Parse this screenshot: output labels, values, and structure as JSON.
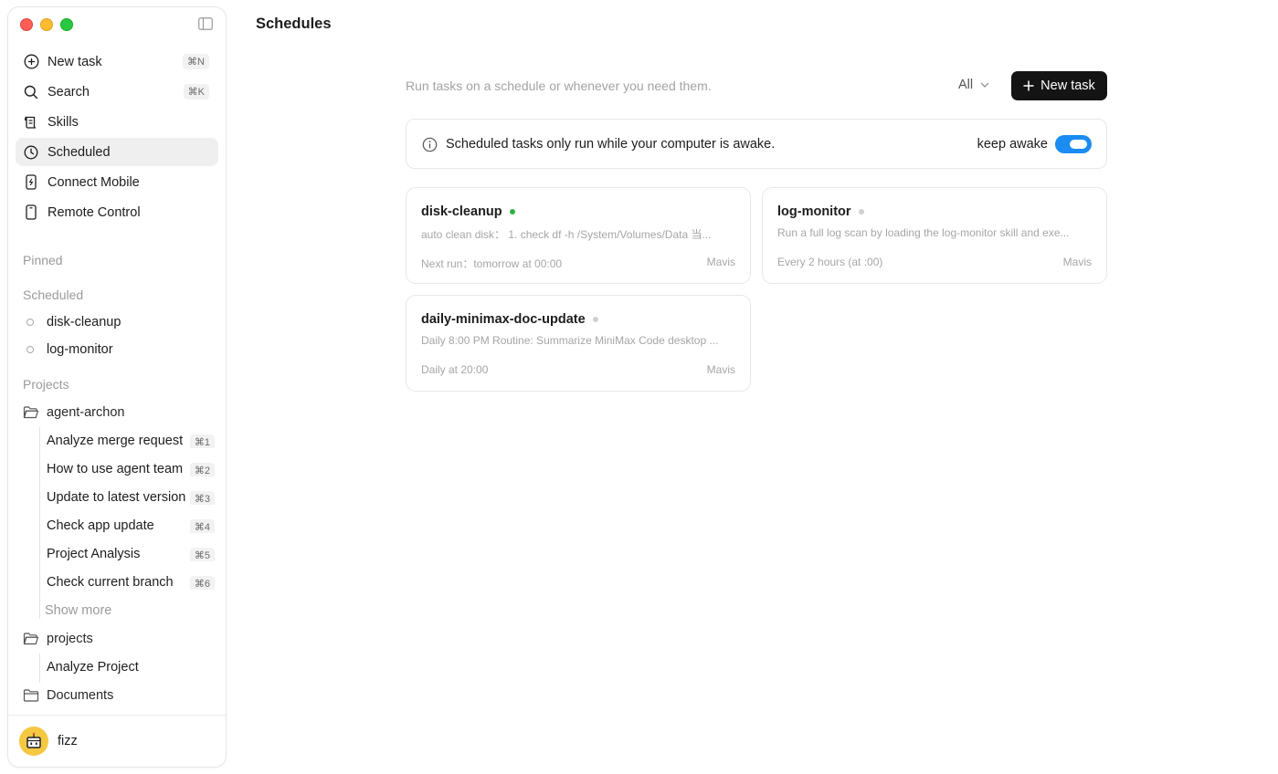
{
  "app": {
    "page_title": "Schedules"
  },
  "sidebar": {
    "nav": [
      {
        "label": "New task",
        "shortcut": "⌘N",
        "icon": "plus-circle-icon"
      },
      {
        "label": "Search",
        "shortcut": "⌘K",
        "icon": "search-icon"
      },
      {
        "label": "Skills",
        "shortcut": "",
        "icon": "scroll-icon"
      },
      {
        "label": "Scheduled",
        "shortcut": "",
        "icon": "clock-icon",
        "active": true
      },
      {
        "label": "Connect Mobile",
        "shortcut": "",
        "icon": "phone-icon"
      },
      {
        "label": "Remote Control",
        "shortcut": "",
        "icon": "remote-icon"
      }
    ],
    "pinned_label": "Pinned",
    "scheduled_label": "Scheduled",
    "scheduled_items": [
      "disk-cleanup",
      "log-monitor"
    ],
    "projects_label": "Projects",
    "projects": [
      {
        "name": "agent-archon",
        "items": [
          {
            "label": "Analyze merge request",
            "shortcut": "⌘1"
          },
          {
            "label": "How to use agent team",
            "shortcut": "⌘2"
          },
          {
            "label": "Update to latest version",
            "shortcut": "⌘3"
          },
          {
            "label": "Check app update",
            "shortcut": "⌘4"
          },
          {
            "label": "Project Analysis",
            "shortcut": "⌘5"
          },
          {
            "label": "Check current branch",
            "shortcut": "⌘6"
          }
        ],
        "show_more": "Show more"
      },
      {
        "name": "projects",
        "items": [
          {
            "label": "Analyze Project"
          }
        ]
      },
      {
        "name": "Documents",
        "items": []
      }
    ],
    "user": {
      "name": "fizz"
    }
  },
  "main": {
    "subtitle": "Run tasks on a schedule or whenever you need them.",
    "filter": "All",
    "new_task_label": "New task",
    "notice": {
      "message": "Scheduled tasks only run while your computer is awake.",
      "toggle_label": "keep awake",
      "toggle_on": true
    },
    "cards": [
      {
        "name": "disk-cleanup",
        "status_color": "#2fb344",
        "description": "auto clean disk： 1. check df -h /System/Volumes/Data 当...",
        "schedule": "Next run：tomorrow at 00:00",
        "owner": "Mavis"
      },
      {
        "name": "log-monitor",
        "status_color": "#cfcfcf",
        "description": "Run a full log scan by loading the log-monitor skill and exe...",
        "schedule": "Every 2 hours (at :00)",
        "owner": "Mavis"
      },
      {
        "name": "daily-minimax-doc-update",
        "status_color": "#cfcfcf",
        "description": "Daily 8:00 PM Routine: Summarize MiniMax Code desktop ...",
        "schedule": "Daily at 20:00",
        "owner": "Mavis"
      }
    ]
  }
}
